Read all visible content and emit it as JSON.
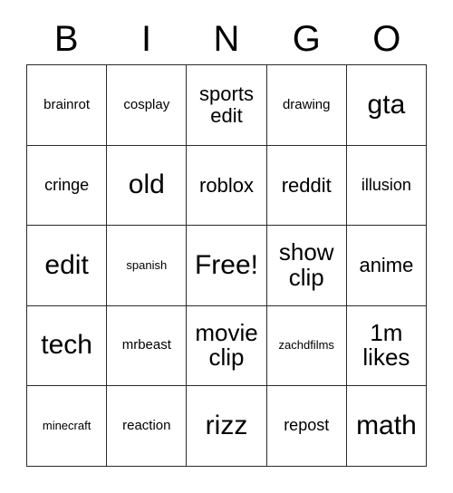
{
  "card": {
    "headers": [
      "B",
      "I",
      "N",
      "G",
      "O"
    ],
    "rows": [
      [
        {
          "text": "brainrot",
          "size": "sm"
        },
        {
          "text": "cosplay",
          "size": "sm"
        },
        {
          "text": "sports edit",
          "size": "lg"
        },
        {
          "text": "drawing",
          "size": "sm"
        },
        {
          "text": "gta",
          "size": "xxl"
        }
      ],
      [
        {
          "text": "cringe",
          "size": "md"
        },
        {
          "text": "old",
          "size": "xxl"
        },
        {
          "text": "roblox",
          "size": "lg"
        },
        {
          "text": "reddit",
          "size": "lg"
        },
        {
          "text": "illusion",
          "size": "md"
        }
      ],
      [
        {
          "text": "edit",
          "size": "xxl"
        },
        {
          "text": "spanish",
          "size": "xs"
        },
        {
          "text": "Free!",
          "size": "xxl"
        },
        {
          "text": "show clip",
          "size": "xl"
        },
        {
          "text": "anime",
          "size": "lg"
        }
      ],
      [
        {
          "text": "tech",
          "size": "xxl"
        },
        {
          "text": "mrbeast",
          "size": "sm"
        },
        {
          "text": "movie clip",
          "size": "xl"
        },
        {
          "text": "zachdfilms",
          "size": "xs"
        },
        {
          "text": "1m likes",
          "size": "xl"
        }
      ],
      [
        {
          "text": "minecraft",
          "size": "xs"
        },
        {
          "text": "reaction",
          "size": "sm"
        },
        {
          "text": "rizz",
          "size": "xxl"
        },
        {
          "text": "repost",
          "size": "md"
        },
        {
          "text": "math",
          "size": "xxl"
        }
      ]
    ]
  }
}
